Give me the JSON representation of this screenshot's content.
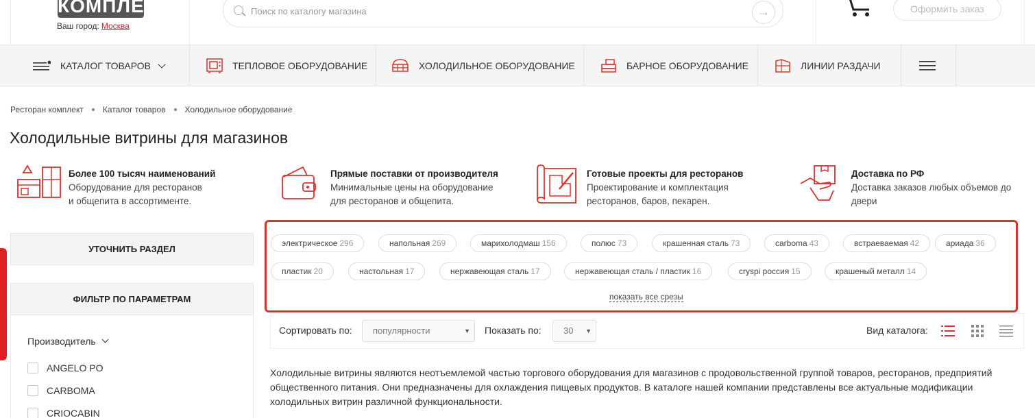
{
  "header": {
    "logo_text": "КОМПЛЕКТ",
    "city_label": "Ваш город:",
    "city_value": "Москва",
    "search_placeholder": "Поиск по каталогу магазина",
    "order_button": "Оформить заказ"
  },
  "nav": {
    "items": [
      {
        "label": "Каталог товаров",
        "icon": "menu-dot-icon"
      },
      {
        "label": "Тепловое оборудование",
        "icon": "oven-icon"
      },
      {
        "label": "Холодильное оборудование",
        "icon": "fridge-display-icon"
      },
      {
        "label": "Барное оборудование",
        "icon": "coffee-machine-icon"
      },
      {
        "label": "Линии раздачи",
        "icon": "serving-line-icon"
      }
    ]
  },
  "breadcrumb": [
    "Ресторан комплект",
    "Каталог товаров",
    "Холодильное оборудование"
  ],
  "page_title": "Холодильные витрины для магазинов",
  "features": [
    {
      "title": "Более 100 тысяч наименований",
      "desc": "Оборудование для ресторанов\nи общепита в ассортименте.",
      "icon": "kitchen-icon"
    },
    {
      "title": "Прямые поставки от производителя",
      "desc": "Минимальные цены на оборудование\nдля ресторанов и общепита.",
      "icon": "wallet-icon"
    },
    {
      "title": "Готовые проекты для ресторанов",
      "desc": "Проектирование и комплектация\nресторанов, баров, пекарен.",
      "icon": "blueprint-icon"
    },
    {
      "title": "Доставка по РФ",
      "desc": "Доставка заказов любых объемов до\nдвери",
      "icon": "delivery-icon"
    }
  ],
  "sidebar": {
    "refine_button": "Уточнить раздел",
    "filter_button": "Фильтр по параметрам",
    "manufacturer_label": "Производитель",
    "manufacturers": [
      "ANGELO PO",
      "CARBOMA",
      "CRIOCABIN"
    ]
  },
  "tags": [
    {
      "label": "электрическое",
      "count": "296"
    },
    {
      "label": "напольная",
      "count": "269"
    },
    {
      "label": "марихолодмаш",
      "count": "156"
    },
    {
      "label": "полюс",
      "count": "73"
    },
    {
      "label": "крашенная сталь",
      "count": "73"
    },
    {
      "label": "carboma",
      "count": "43"
    },
    {
      "label": "встраеваемая",
      "count": "42"
    },
    {
      "label": "ариада",
      "count": "36"
    },
    {
      "label": "пластик",
      "count": "20"
    },
    {
      "label": "настольная",
      "count": "17"
    },
    {
      "label": "нержавеющая сталь",
      "count": "17"
    },
    {
      "label": "нержавеющая сталь / пластик",
      "count": "16"
    },
    {
      "label": "cryspi россия",
      "count": "15"
    },
    {
      "label": "крашеный металл",
      "count": "14"
    }
  ],
  "show_all": "показать все срезы",
  "sortbar": {
    "sort_label": "Сортировать по:",
    "sort_value": "популярности",
    "show_label": "Показать по:",
    "show_value": "30",
    "view_label": "Вид каталога:"
  },
  "description": "Холодильные витрины являются неотъемлемой частью торгового оборудования для магазинов с продовольственной группой товаров, ресторанов, предприятий общественного питания. Они предназначены для охлаждения пищевых продуктов. В каталоге нашей компании представлены все актуальные модификации холодильных витрин различной функциональности.",
  "colors": {
    "accent": "#d9332f",
    "text": "#222222",
    "nav_bg": "#f5f5f5"
  }
}
